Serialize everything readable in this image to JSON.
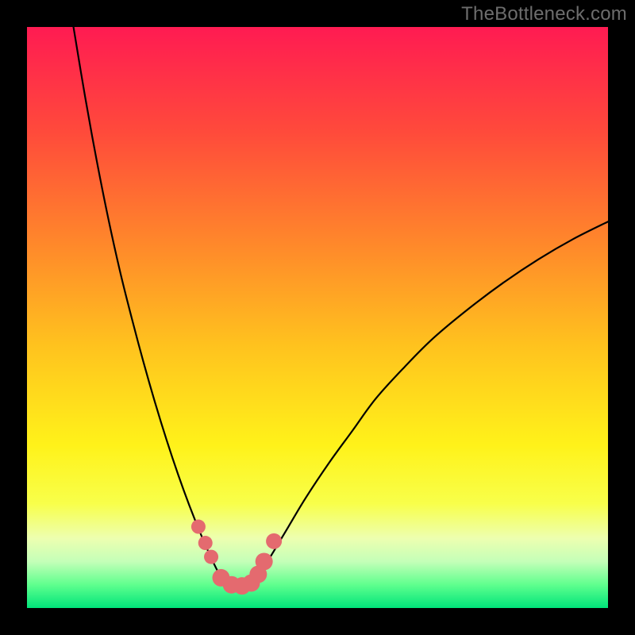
{
  "watermark": "TheBottleneck.com",
  "chart_data": {
    "type": "line",
    "title": "",
    "xlabel": "",
    "ylabel": "",
    "xlim": [
      0,
      100
    ],
    "ylim": [
      0,
      100
    ],
    "gradient_stops": [
      {
        "offset": 0,
        "color": "#ff1b52"
      },
      {
        "offset": 18,
        "color": "#ff4a3b"
      },
      {
        "offset": 38,
        "color": "#ff8a2a"
      },
      {
        "offset": 55,
        "color": "#ffc31e"
      },
      {
        "offset": 72,
        "color": "#fff21a"
      },
      {
        "offset": 82,
        "color": "#f8ff4a"
      },
      {
        "offset": 88,
        "color": "#edffb0"
      },
      {
        "offset": 92,
        "color": "#c4ffb8"
      },
      {
        "offset": 96,
        "color": "#5fff8e"
      },
      {
        "offset": 100,
        "color": "#00e47a"
      }
    ],
    "series": [
      {
        "name": "left_branch",
        "x": [
          8,
          10,
          12,
          14,
          16,
          18,
          20,
          22,
          24,
          26,
          28,
          30,
          32,
          33.5
        ],
        "y": [
          100,
          88,
          77,
          67,
          58,
          50,
          42.5,
          35.5,
          29,
          23,
          17.5,
          12.5,
          8,
          5
        ]
      },
      {
        "name": "right_branch",
        "x": [
          40,
          42,
          45,
          48,
          52,
          56,
          60,
          65,
          70,
          76,
          82,
          88,
          94,
          100
        ],
        "y": [
          6,
          9,
          14,
          19,
          25,
          30.5,
          36,
          41.5,
          46.5,
          51.5,
          56,
          60,
          63.5,
          66.5
        ]
      }
    ],
    "valley_floor": {
      "x": [
        33.5,
        35,
        36.5,
        38,
        40
      ],
      "y": [
        5,
        3.8,
        3.5,
        4,
        6
      ]
    },
    "markers": {
      "name": "highlight_points",
      "color": "#e46a6f",
      "points": [
        {
          "x": 29.5,
          "y": 14,
          "r": 9
        },
        {
          "x": 30.7,
          "y": 11.2,
          "r": 9
        },
        {
          "x": 31.7,
          "y": 8.8,
          "r": 9
        },
        {
          "x": 33.4,
          "y": 5.2,
          "r": 11
        },
        {
          "x": 35.2,
          "y": 4.0,
          "r": 11
        },
        {
          "x": 37.0,
          "y": 3.8,
          "r": 11
        },
        {
          "x": 38.6,
          "y": 4.3,
          "r": 11
        },
        {
          "x": 39.8,
          "y": 5.8,
          "r": 11
        },
        {
          "x": 40.8,
          "y": 8.0,
          "r": 11
        },
        {
          "x": 42.5,
          "y": 11.5,
          "r": 10
        }
      ]
    }
  }
}
